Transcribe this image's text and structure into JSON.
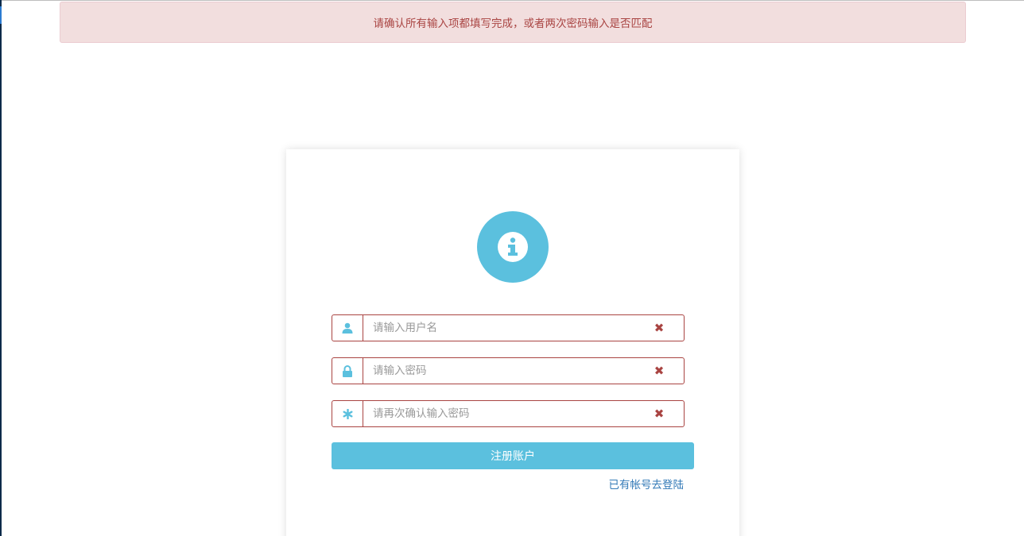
{
  "alert": {
    "message": "请确认所有输入项都填写完成，或者两次密码输入是否匹配"
  },
  "form": {
    "status_icon": "info-circle-icon",
    "fields": [
      {
        "name": "username",
        "icon": "user-icon",
        "placeholder": "请输入用户名",
        "value": "",
        "type": "text"
      },
      {
        "name": "password",
        "icon": "lock-icon",
        "placeholder": "请输入密码",
        "value": "",
        "type": "password"
      },
      {
        "name": "confirm-password",
        "icon": "asterisk-icon",
        "placeholder": "请再次确认输入密码",
        "value": "",
        "type": "password"
      }
    ],
    "clear_symbol": "✖",
    "submit_label": "注册账户",
    "login_link": "已有帐号去登陆"
  },
  "colors": {
    "error": "#a94442",
    "error_bg": "#f2dede",
    "info": "#5bc0de",
    "link": "#337ab7"
  }
}
